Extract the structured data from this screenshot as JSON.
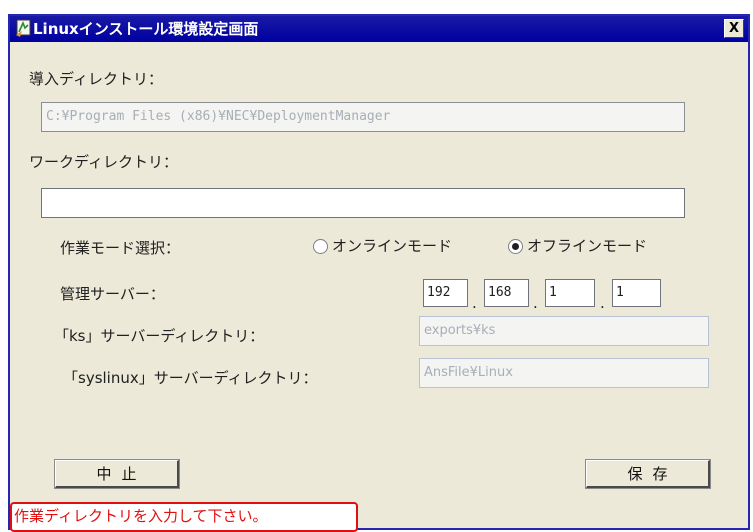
{
  "window": {
    "title": "Linuxインストール環境設定画面",
    "close_label": "X"
  },
  "form": {
    "install_dir": {
      "label": "導入ディレクトリ：",
      "value": "C:¥Program Files (x86)¥NEC¥DeploymentManager"
    },
    "work_dir": {
      "label": "ワークディレクトリ：",
      "value": ""
    },
    "mode": {
      "label": "作業モード選択：",
      "options": [
        {
          "label": "オンラインモード",
          "selected": false
        },
        {
          "label": "オフラインモード",
          "selected": true
        }
      ]
    },
    "server": {
      "label": "管理サーバー：",
      "ip": [
        "192",
        "168",
        "1",
        "1"
      ],
      "separator": "."
    },
    "ks_dir": {
      "label": "「ks」サーバーディレクトリ：",
      "value": "exports¥ks"
    },
    "syslinux_dir": {
      "label": "「syslinux」サーバーディレクトリ：",
      "value": "AnsFile¥Linux"
    }
  },
  "buttons": {
    "cancel_label": "中止",
    "save_label": "保存"
  },
  "status": {
    "message": "作業ディレクトリを入力して下さい。"
  },
  "colors": {
    "title_bar": "#0000a0",
    "dialog_bg": "#ece9d8",
    "error_red": "#e01010",
    "disabled_text": "#a7aeb6"
  },
  "icons": {
    "title": "linux-setup-icon"
  }
}
